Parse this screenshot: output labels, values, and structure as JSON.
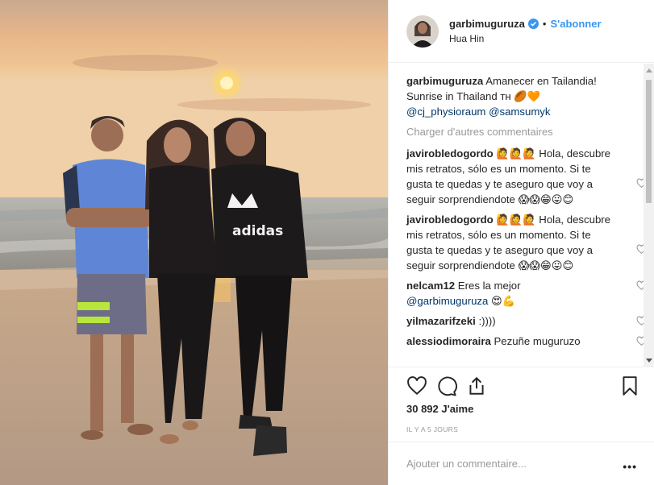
{
  "header": {
    "username": "garbimuguruza",
    "separator": "•",
    "follow_label": "S'abonner",
    "location": "Hua Hin"
  },
  "caption": {
    "username": "garbimuguruza",
    "text": "Amanecer en Tailandia! Sunrise in Thailand ᴛʜ ",
    "emojis": "🏉🧡",
    "mention1": "@cj_physioraum",
    "mention2": "@samsumyk"
  },
  "load_more": "Charger d'autres commentaires",
  "comments": [
    {
      "user": "javiroblедogordo",
      "text_parts": [
        "🙋🙋🙋 Hola, descubre mis retratos, sólo es un momento. Si te gusta te quedas y te aseguro que voy a seguir sorprendiendote ",
        "😱😱😁😛😊"
      ]
    },
    {
      "user": "javirobledogordo",
      "text_parts": [
        "🙋🙋🙋 Hola, descubre mis retratos, sólo es un momento. Si te gusta te quedas y te aseguro que voy a seguir sorprendiendote ",
        "😱😱😁😛😊"
      ]
    },
    {
      "user": "nelcam12",
      "text_parts": [
        "Eres la mejor "
      ],
      "mention": "@garbimuguruza",
      "emojis": " 😍💪"
    },
    {
      "user": "yilmazarifzeki",
      "text_parts": [
        ":))))"
      ]
    },
    {
      "user": "alessiodimoraira",
      "text_parts": [
        "Pezuñe muguruzo"
      ]
    }
  ],
  "likes": "30 892 J'aime",
  "time_ago": "IL Y A 5 JOURS",
  "add_comment_placeholder": "Ajouter un commentaire...",
  "more_label": "•••",
  "icons": {
    "verified": "verified-badge-icon",
    "like": "heart-icon",
    "comment": "comment-bubble-icon",
    "share": "share-icon",
    "save": "bookmark-icon"
  },
  "colors": {
    "link": "#3897f0",
    "mention": "#003569",
    "muted": "#999999",
    "text": "#262626"
  }
}
